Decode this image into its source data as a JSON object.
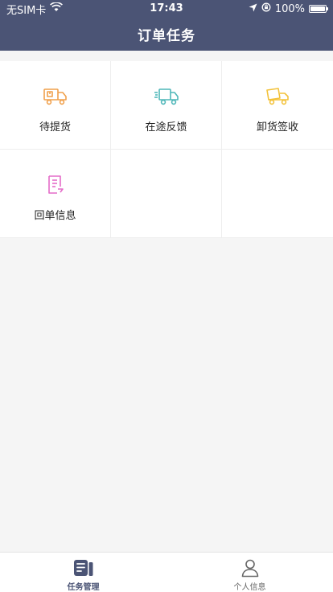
{
  "status_bar": {
    "carrier": "无SIM卡",
    "time": "17:43",
    "battery": "100%"
  },
  "header": {
    "title": "订单任务"
  },
  "grid": {
    "items": [
      {
        "label": "待提货",
        "icon": "truck-loading-icon",
        "color": "#f0a04b"
      },
      {
        "label": "在途反馈",
        "icon": "truck-moving-icon",
        "color": "#4fb7b9"
      },
      {
        "label": "卸货签收",
        "icon": "truck-dump-icon",
        "color": "#f3c23a"
      },
      {
        "label": "回单信息",
        "icon": "receipt-icon",
        "color": "#e46cc8"
      }
    ]
  },
  "tabbar": {
    "tabs": [
      {
        "label": "任务管理",
        "icon": "task-management-icon",
        "active": true
      },
      {
        "label": "个人信息",
        "icon": "person-icon",
        "active": false
      }
    ]
  },
  "colors": {
    "header_bg": "#4b5475",
    "page_bg": "#f5f5f5",
    "active_tab": "#4b5475"
  }
}
